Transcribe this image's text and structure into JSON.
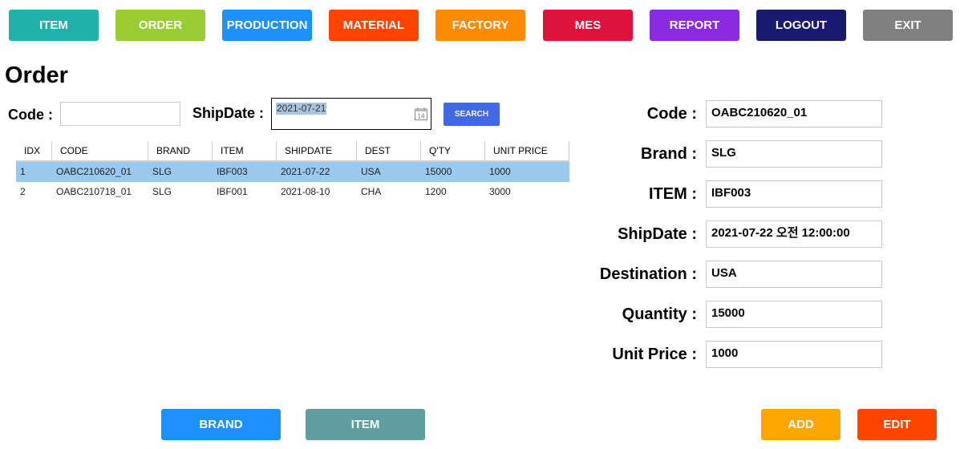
{
  "nav": {
    "buttons": [
      {
        "label": "ITEM",
        "color": "#20b2aa"
      },
      {
        "label": "ORDER",
        "color": "#9acd32"
      },
      {
        "label": "PRODUCTION",
        "color": "#1e90ff"
      },
      {
        "label": "MATERIAL",
        "color": "#ff4500"
      },
      {
        "label": "FACTORY",
        "color": "#ff8c00"
      },
      {
        "label": "MES",
        "color": "#dc143c"
      },
      {
        "label": "REPORT",
        "color": "#8a2be2"
      },
      {
        "label": "LOGOUT",
        "color": "#191970"
      },
      {
        "label": "EXIT",
        "color": "#808080"
      }
    ]
  },
  "page": {
    "title": "Order"
  },
  "search": {
    "code_label": "Code :",
    "code_value": "",
    "shipdate_label": "ShipDate :",
    "shipdate_value": "2021-07-21",
    "calendar_day": "14",
    "search_label": "SEARCH"
  },
  "grid": {
    "columns": [
      "IDX",
      "CODE",
      "BRAND",
      "ITEM",
      "SHIPDATE",
      "DEST",
      "Q'TY",
      "UNIT PRICE"
    ],
    "rows": [
      {
        "idx": "1",
        "code": "OABC210620_01",
        "brand": "SLG",
        "item": "IBF003",
        "shipdate": "2021-07-22",
        "dest": "USA",
        "qty": "15000",
        "price": "1000",
        "selected": true
      },
      {
        "idx": "2",
        "code": "OABC210718_01",
        "brand": "SLG",
        "item": "IBF001",
        "shipdate": "2021-08-10",
        "dest": "CHA",
        "qty": "1200",
        "price": "3000",
        "selected": false
      }
    ]
  },
  "detail": {
    "fields": [
      {
        "label": "Code :",
        "value": "OABC210620_01"
      },
      {
        "label": "Brand :",
        "value": "SLG"
      },
      {
        "label": "ITEM :",
        "value": "IBF003"
      },
      {
        "label": "ShipDate :",
        "value": "2021-07-22 오전 12:00:00"
      },
      {
        "label": "Destination :",
        "value": "USA"
      },
      {
        "label": "Quantity :",
        "value": "15000"
      },
      {
        "label": "Unit Price :",
        "value": "1000"
      }
    ]
  },
  "bottom": {
    "brand_label": "BRAND",
    "brand_color": "#1e90ff",
    "item_label": "ITEM",
    "item_color": "#5f9ea0",
    "add_label": "ADD",
    "add_color": "#ffa500",
    "edit_label": "EDIT",
    "edit_color": "#ff4500"
  }
}
